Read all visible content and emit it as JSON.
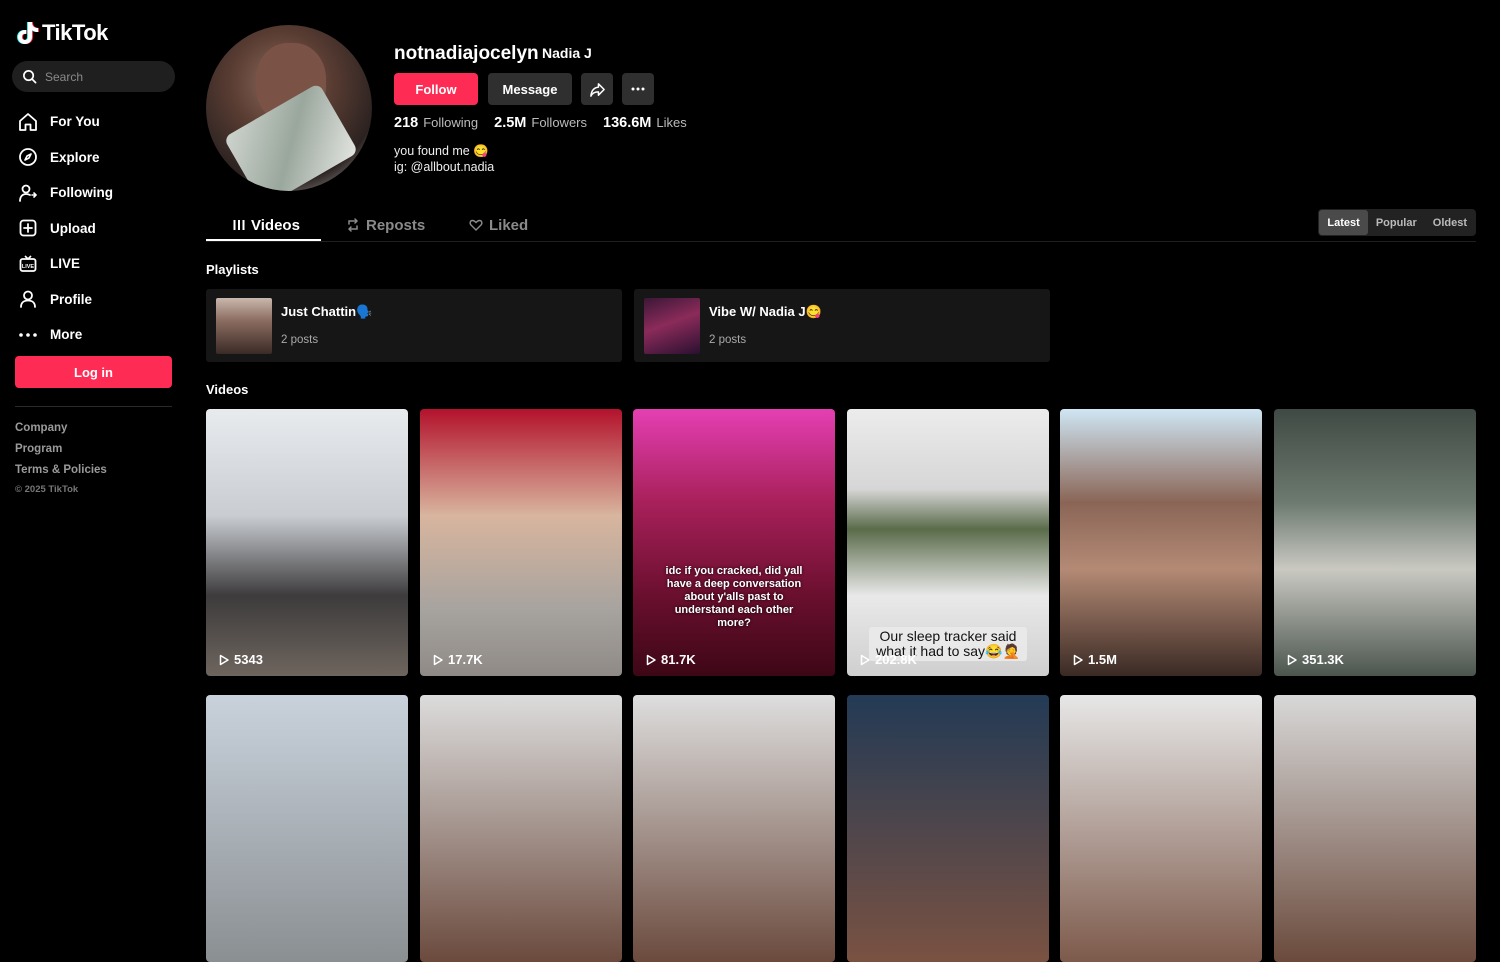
{
  "brand": {
    "name": "TikTok"
  },
  "search": {
    "placeholder": "Search"
  },
  "nav": [
    {
      "label": "For You",
      "icon": "home-icon"
    },
    {
      "label": "Explore",
      "icon": "compass-icon"
    },
    {
      "label": "Following",
      "icon": "following-icon"
    },
    {
      "label": "Upload",
      "icon": "upload-icon"
    },
    {
      "label": "LIVE",
      "icon": "live-icon"
    },
    {
      "label": "Profile",
      "icon": "profile-icon"
    },
    {
      "label": "More",
      "icon": "more-icon"
    }
  ],
  "login_label": "Log in",
  "footer": {
    "links": [
      "Company",
      "Program",
      "Terms & Policies"
    ],
    "copyright": "© 2025 TikTok"
  },
  "profile": {
    "username": "notnadiajocelyn",
    "nickname": "Nadia J",
    "follow_label": "Follow",
    "message_label": "Message",
    "stats": [
      {
        "value": "218",
        "label": "Following"
      },
      {
        "value": "2.5M",
        "label": "Followers"
      },
      {
        "value": "136.6M",
        "label": "Likes"
      }
    ],
    "bio": [
      "you found me 😋",
      "ig: @allbout.nadia"
    ]
  },
  "tabs": [
    "Videos",
    "Reposts",
    "Liked"
  ],
  "sort": {
    "options": [
      "Latest",
      "Popular",
      "Oldest"
    ],
    "selected": "Latest"
  },
  "playlists_title": "Playlists",
  "playlists": [
    {
      "title": "Just Chattin🗣️",
      "count": "2 posts"
    },
    {
      "title": "Vibe W/ Nadia J😋",
      "count": "2 posts"
    }
  ],
  "videos_title": "Videos",
  "videos": [
    {
      "views": "5343",
      "caption": ""
    },
    {
      "views": "17.7K",
      "caption": ""
    },
    {
      "views": "81.7K",
      "caption": "idc if you cracked, did yall have a deep conversation about y'alls past to understand each other more?"
    },
    {
      "views": "202.8K",
      "caption": "Our sleep tracker said what it had to say😂🤦"
    },
    {
      "views": "1.5M",
      "caption": ""
    },
    {
      "views": "351.3K",
      "caption": ""
    }
  ],
  "colors": {
    "accent": "#fe2c55",
    "background": "#000000"
  }
}
